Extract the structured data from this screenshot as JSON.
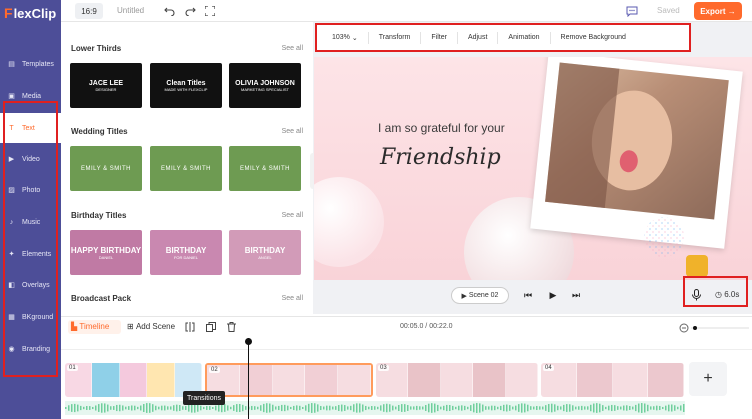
{
  "brand": {
    "logo_f": "F",
    "logo_rest": "lexClip",
    "accent": "#ff6a2c",
    "sidebar_bg": "#4d4e98"
  },
  "sidebar": {
    "items": [
      {
        "label": "Templates",
        "icon": "templates-icon"
      },
      {
        "label": "Media",
        "icon": "media-icon"
      },
      {
        "label": "Text",
        "icon": "text-icon",
        "active": true
      },
      {
        "label": "Video",
        "icon": "video-icon"
      },
      {
        "label": "Photo",
        "icon": "photo-icon"
      },
      {
        "label": "Music",
        "icon": "music-icon"
      },
      {
        "label": "Elements",
        "icon": "elements-icon"
      },
      {
        "label": "Overlays",
        "icon": "overlays-icon"
      },
      {
        "label": "BKground",
        "icon": "background-icon"
      },
      {
        "label": "Branding",
        "icon": "branding-icon"
      }
    ]
  },
  "topbar": {
    "ratio": "16:9",
    "title": "Untitled",
    "saved": "Saved",
    "export": "Export"
  },
  "panel": {
    "sections": [
      {
        "title": "Lower Thirds",
        "see_all": "See all",
        "thumbs": [
          {
            "line1": "JACE LEE",
            "line2": "DESIGNER"
          },
          {
            "line1": "Clean Titles",
            "line2": "MADE WITH FLEXCLIP"
          },
          {
            "line1": "OLIVIA JOHNSON",
            "line2": "MARKETING SPECIALIST"
          }
        ]
      },
      {
        "title": "Wedding Titles",
        "see_all": "See all",
        "thumbs": [
          {
            "line1": "EMILY & SMITH",
            "line2": ""
          },
          {
            "line1": "EMILY & SMITH",
            "line2": ""
          },
          {
            "line1": "EMILY & SMITH",
            "line2": ""
          }
        ]
      },
      {
        "title": "Birthday Titles",
        "see_all": "See all",
        "thumbs": [
          {
            "line1": "HAPPY BIRTHDAY",
            "line2": "DANIEL"
          },
          {
            "line1": "BIRTHDAY",
            "line2": "FOR DANIEL"
          },
          {
            "line1": "BIRTHDAY",
            "line2": "ANGEL"
          }
        ]
      },
      {
        "title": "Broadcast Pack",
        "see_all": "See all",
        "thumbs": []
      }
    ]
  },
  "toolbar": {
    "zoom": "103%",
    "tools": [
      "Transform",
      "Filter",
      "Adjust",
      "Animation",
      "Remove Background"
    ]
  },
  "canvas": {
    "line1": "I am so grateful for your",
    "line2": "Friendship"
  },
  "playbar": {
    "scene": "Scene 02",
    "duration": "6.0s"
  },
  "timeline": {
    "label": "Timeline",
    "add_scene": "Add Scene",
    "time": "00:05.0 / 00:22.0",
    "tooltip": "Transitions",
    "clips": [
      {
        "num": "01",
        "selected": false
      },
      {
        "num": "02",
        "selected": true
      },
      {
        "num": "03",
        "selected": false
      },
      {
        "num": "04",
        "selected": false
      }
    ],
    "add": "+"
  }
}
